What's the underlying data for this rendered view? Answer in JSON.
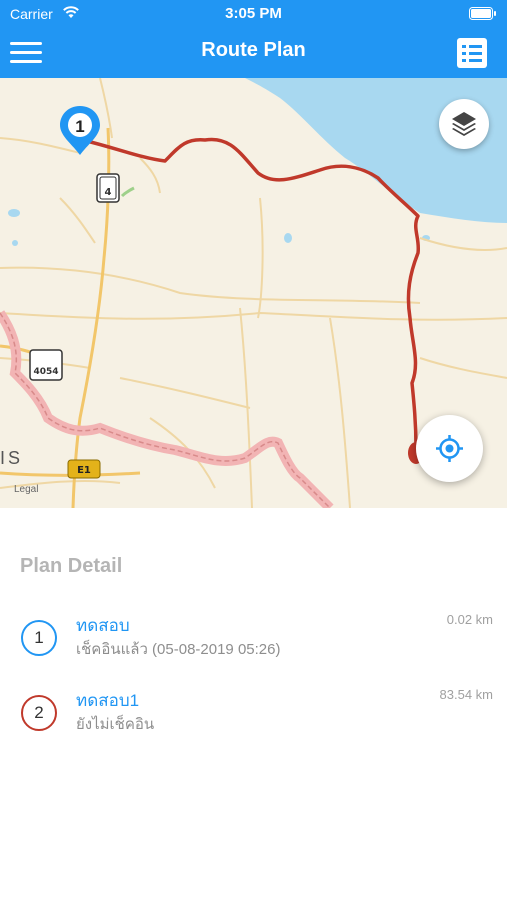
{
  "status_bar": {
    "carrier": "Carrier",
    "time": "3:05 PM"
  },
  "nav": {
    "title": "Route Plan",
    "menu_icon": "hamburger-menu-icon",
    "list_icon": "list-icon"
  },
  "map": {
    "markers": [
      {
        "label": "1"
      }
    ],
    "labels": {
      "highway_4": "4",
      "highway_4054": "4054",
      "route_e1": "E1",
      "region_partial": "IS",
      "legal": "Legal"
    },
    "route_color": "#c0392b",
    "water_color": "#a8d8f0",
    "layers_icon": "layers-icon",
    "locate_icon": "locate-me-icon"
  },
  "plan": {
    "title": "Plan Detail",
    "items": [
      {
        "index": "1",
        "name": "ทดสอบ",
        "status": "เช็คอินแล้ว (05-08-2019 05:26)",
        "distance": "0.02 km",
        "color": "#2196f3"
      },
      {
        "index": "2",
        "name": "ทดสอบ1",
        "status": "ยังไม่เช็คอิน",
        "distance": "83.54 km",
        "color": "#c0392b"
      }
    ]
  },
  "colors": {
    "primary": "#2196f3",
    "title_gray": "#b5b5b5"
  }
}
